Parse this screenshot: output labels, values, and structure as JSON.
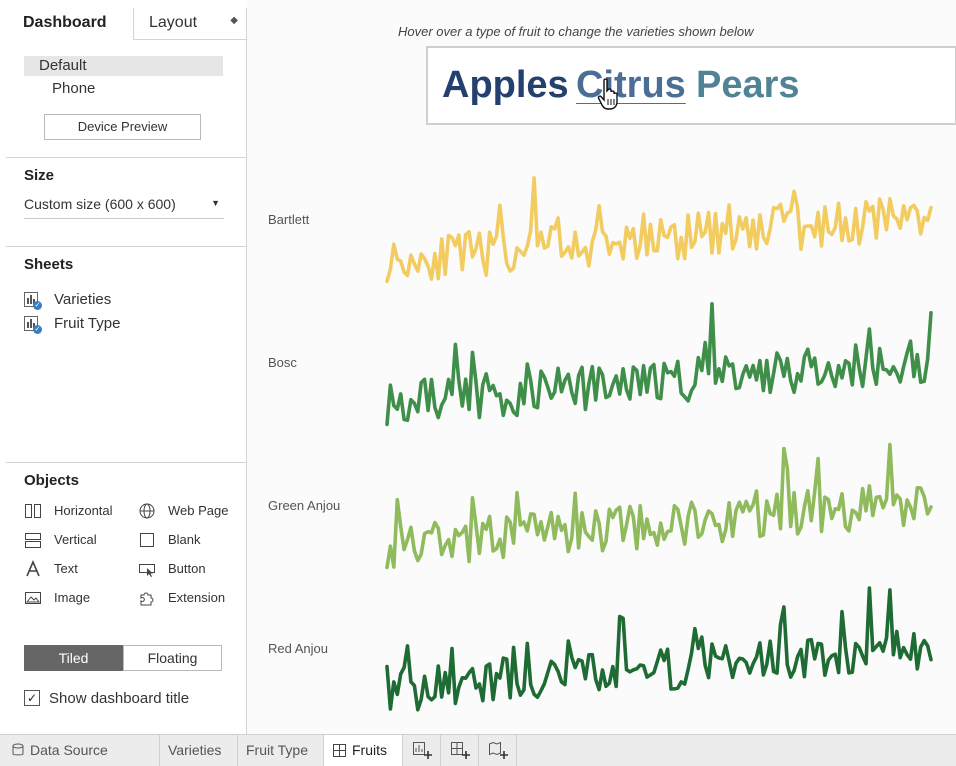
{
  "left_panel": {
    "tabs": {
      "dashboard": "Dashboard",
      "layout": "Layout"
    },
    "device": {
      "default": "Default",
      "phone": "Phone",
      "preview_button": "Device Preview"
    },
    "size": {
      "title": "Size",
      "value": "Custom size (600 x 600)"
    },
    "sheets": {
      "title": "Sheets",
      "items": [
        "Varieties",
        "Fruit Type"
      ]
    },
    "objects": {
      "title": "Objects",
      "items": [
        "Horizontal",
        "Web Page",
        "Vertical",
        "Blank",
        "Text",
        "Button",
        "Image",
        "Extension"
      ]
    },
    "mode": {
      "tiled": "Tiled",
      "floating": "Floating",
      "selected": "Tiled"
    },
    "show_title": {
      "label": "Show dashboard title",
      "checked": true
    }
  },
  "canvas": {
    "hint": "Hover over a type of fruit to change the varieties shown below",
    "fruits": [
      "Apples",
      "Citrus",
      "Pears"
    ],
    "hovered_fruit": "Citrus",
    "varieties": [
      {
        "name": "Bartlett",
        "color": "#f2cc60"
      },
      {
        "name": "Bosc",
        "color": "#3f8f4a"
      },
      {
        "name": "Green Anjou",
        "color": "#8fbb5c"
      },
      {
        "name": "Red Anjou",
        "color": "#1f6b34"
      }
    ]
  },
  "bottom_tabs": {
    "data_source": "Data Source",
    "sheets": [
      "Varieties",
      "Fruit Type",
      "Fruits"
    ],
    "active": "Fruits",
    "new_icons": [
      "new-worksheet-icon",
      "new-dashboard-icon",
      "new-story-icon"
    ]
  }
}
